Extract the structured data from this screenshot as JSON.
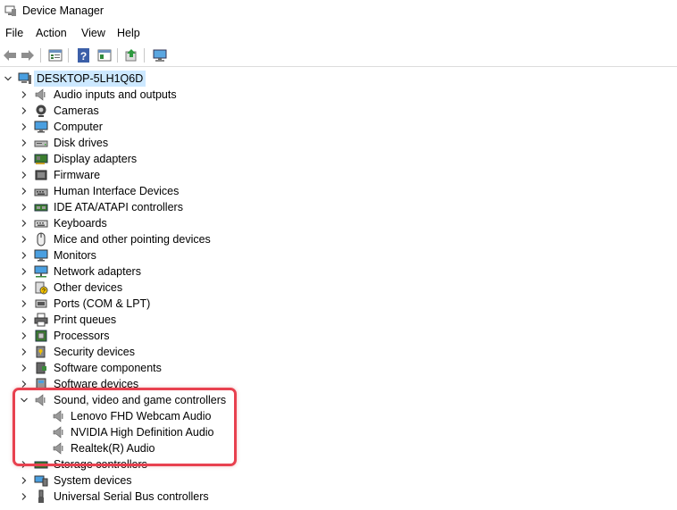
{
  "window": {
    "title": "Device Manager",
    "icon": "device-manager-icon"
  },
  "menu": [
    "File",
    "Action",
    "View",
    "Help"
  ],
  "toolbar": {
    "buttons": [
      "back-icon",
      "forward-icon",
      "properties-icon",
      "help-icon",
      "view-icon",
      "update-driver-icon",
      "monitor-scan-icon"
    ]
  },
  "tree": {
    "root": "DESKTOP-5LH1Q6D",
    "categories": [
      {
        "label": "Audio inputs and outputs",
        "icon": "speaker-icon"
      },
      {
        "label": "Cameras",
        "icon": "camera-icon"
      },
      {
        "label": "Computer",
        "icon": "computer-icon"
      },
      {
        "label": "Disk drives",
        "icon": "disk-drive-icon"
      },
      {
        "label": "Display adapters",
        "icon": "display-adapter-icon"
      },
      {
        "label": "Firmware",
        "icon": "firmware-icon"
      },
      {
        "label": "Human Interface Devices",
        "icon": "hid-icon"
      },
      {
        "label": "IDE ATA/ATAPI controllers",
        "icon": "ide-controller-icon"
      },
      {
        "label": "Keyboards",
        "icon": "keyboard-icon"
      },
      {
        "label": "Mice and other pointing devices",
        "icon": "mouse-icon"
      },
      {
        "label": "Monitors",
        "icon": "monitor-icon"
      },
      {
        "label": "Network adapters",
        "icon": "network-adapter-icon"
      },
      {
        "label": "Other devices",
        "icon": "unknown-device-icon"
      },
      {
        "label": "Ports (COM & LPT)",
        "icon": "port-icon"
      },
      {
        "label": "Print queues",
        "icon": "printer-icon"
      },
      {
        "label": "Processors",
        "icon": "processor-icon"
      },
      {
        "label": "Security devices",
        "icon": "security-icon"
      },
      {
        "label": "Software components",
        "icon": "software-component-icon"
      },
      {
        "label": "Software devices",
        "icon": "software-device-icon"
      },
      {
        "label": "Sound, video and game controllers",
        "icon": "speaker-icon",
        "expanded": true
      },
      {
        "label": "Storage controllers",
        "icon": "storage-controller-icon"
      },
      {
        "label": "System devices",
        "icon": "system-devices-icon"
      },
      {
        "label": "Universal Serial Bus controllers",
        "icon": "usb-icon"
      }
    ],
    "sound_children": [
      "Lenovo FHD Webcam Audio",
      "NVIDIA High Definition Audio",
      "Realtek(R) Audio"
    ]
  },
  "colors": {
    "selection": "#cce8ff",
    "highlight_border": "#e8414f"
  }
}
